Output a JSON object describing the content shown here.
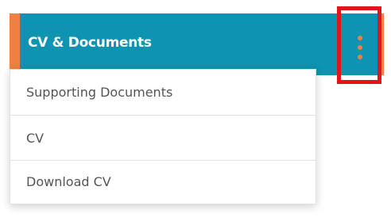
{
  "header": {
    "title": "CV & Documents",
    "background_color": "#0e93b0",
    "accent_color": "#f07f43"
  },
  "kebab_menu": {
    "icon": "more-vertical-icon",
    "highlight_color": "#e0141a"
  },
  "dropdown": {
    "items": [
      {
        "label": "Supporting Documents"
      },
      {
        "label": "CV"
      },
      {
        "label": "Download CV"
      }
    ]
  }
}
